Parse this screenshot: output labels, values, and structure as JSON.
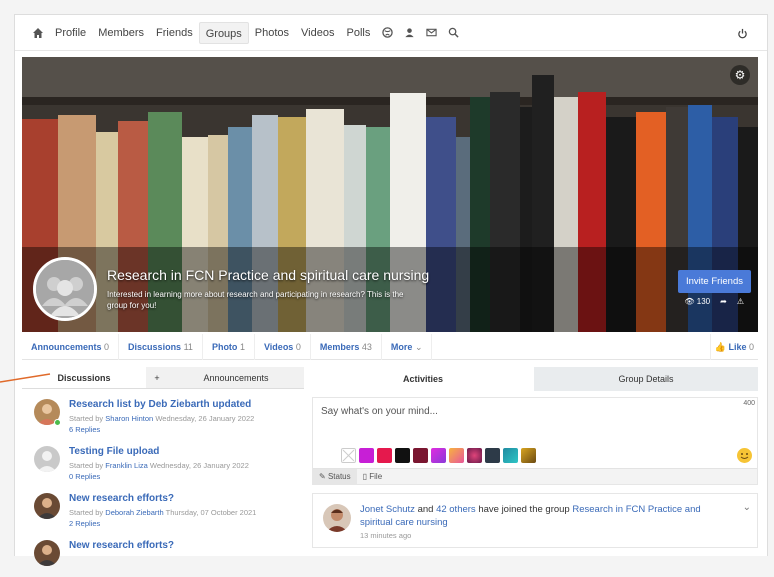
{
  "nav": {
    "items": [
      "Profile",
      "Members",
      "Friends",
      "Groups",
      "Photos",
      "Videos",
      "Polls"
    ],
    "active": "Groups",
    "icons": [
      "home-icon",
      "globe-icon",
      "user-alert-icon",
      "mail-icon",
      "search-icon",
      "power-icon"
    ]
  },
  "group": {
    "title": "Research in FCN Practice and spiritual care nursing",
    "description": "Interested in learning more about research and participating in research? This is the group for you!",
    "invite_label": "Invite Friends",
    "views": "130"
  },
  "subtabs": [
    {
      "label": "Announcements",
      "count": "0"
    },
    {
      "label": "Discussions",
      "count": "11"
    },
    {
      "label": "Photo",
      "count": "1"
    },
    {
      "label": "Videos",
      "count": "0"
    },
    {
      "label": "Members",
      "count": "43"
    },
    {
      "label": "More",
      "count": ""
    }
  ],
  "like": {
    "label": "Like",
    "count": "0"
  },
  "left_tabs": {
    "discussions": "Discussions",
    "plus": "+",
    "announcements": "Announcements"
  },
  "discussions": [
    {
      "title": "Research list by Deb Ziebarth updated",
      "started": "Started by",
      "author": "Sharon Hinton",
      "date": "Wednesday, 26 January 2022",
      "replies": "6 Replies"
    },
    {
      "title": "Testing File upload",
      "started": "Started by",
      "author": "Franklin Liza",
      "date": "Wednesday, 26 January 2022",
      "replies": "0 Replies"
    },
    {
      "title": "New research efforts?",
      "started": "Started by",
      "author": "Deborah Ziebarth",
      "date": "Thursday, 07 October 2021",
      "replies": "2 Replies"
    },
    {
      "title": "New research efforts?",
      "started": "",
      "author": "",
      "date": "",
      "replies": ""
    }
  ],
  "right_tabs": {
    "activities": "Activities",
    "details": "Group Details"
  },
  "composer": {
    "placeholder": "Say what's on your mind...",
    "count": "400",
    "status_tab": "Status",
    "file_tab": "File",
    "colors": [
      "#c71fd6",
      "#e5194d",
      "#111111",
      "#7a1630",
      "#e02ce0",
      "#f7b23f",
      "#c23a6b",
      "#2d3a48",
      "#1f8aa0",
      "#d9a520"
    ]
  },
  "activity": {
    "actor": "Jonet Schutz",
    "joiner": "and",
    "others": "42 others",
    "verb": "have joined the group",
    "group": "Research in FCN Practice and spiritual care nursing",
    "time": "13 minutes ago"
  }
}
